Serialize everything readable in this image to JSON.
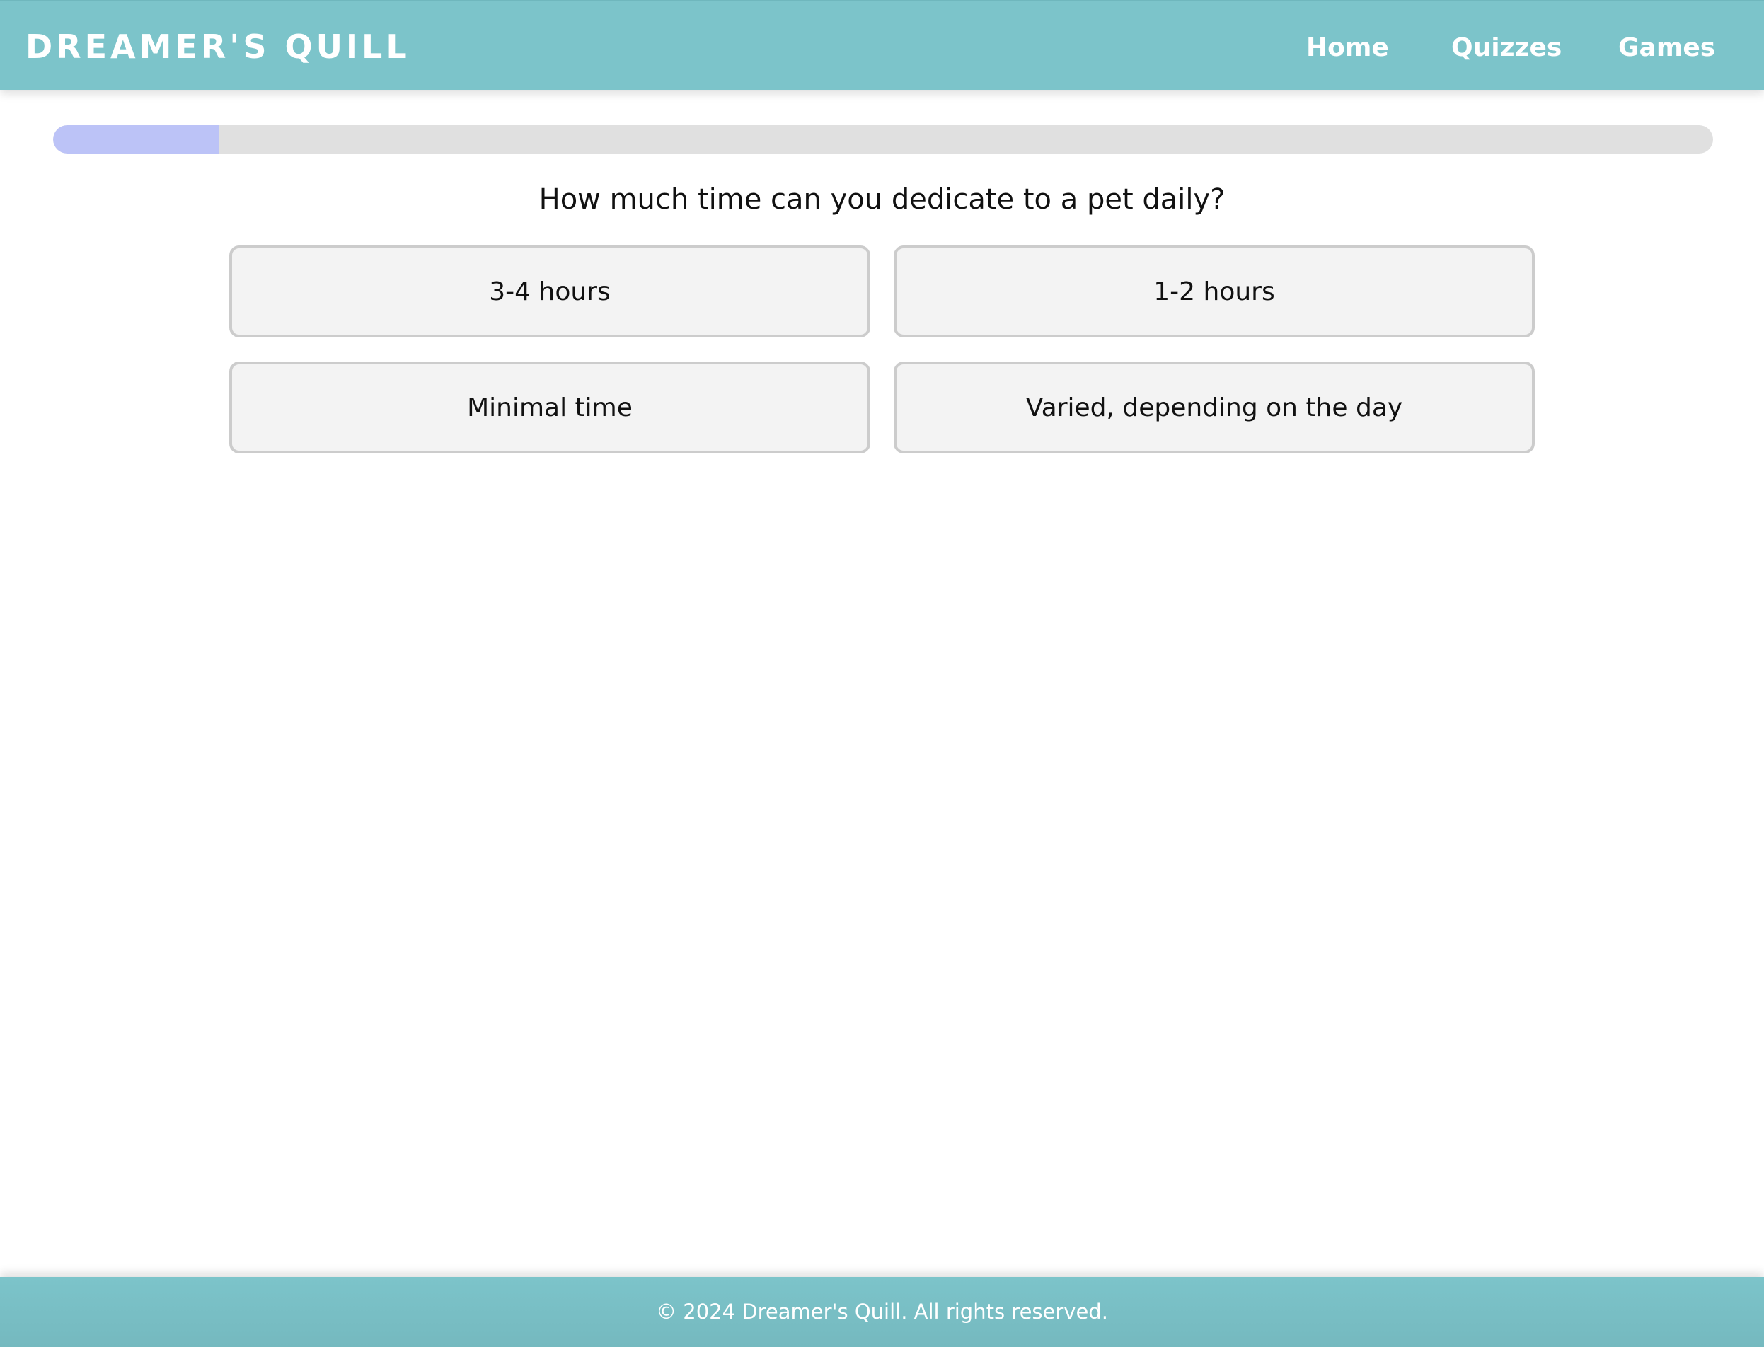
{
  "header": {
    "brand": "DREAMER'S QUILL",
    "nav": [
      {
        "label": "Home"
      },
      {
        "label": "Quizzes"
      },
      {
        "label": "Games"
      }
    ]
  },
  "quiz": {
    "progress_fraction": 0.1,
    "question": "How much time can you dedicate to a pet daily?",
    "options": [
      {
        "label": "3-4 hours"
      },
      {
        "label": "1-2 hours"
      },
      {
        "label": "Minimal time"
      },
      {
        "label": "Varied, depending on the day"
      }
    ]
  },
  "footer": {
    "text": "© 2024 Dreamer's Quill. All rights reserved."
  },
  "colors": {
    "header_bg": "#7cc4ca",
    "progress_fill": "#bcc3f7",
    "progress_track": "#e0e0e0",
    "option_bg": "#f3f3f3",
    "option_border": "#cccccc"
  }
}
